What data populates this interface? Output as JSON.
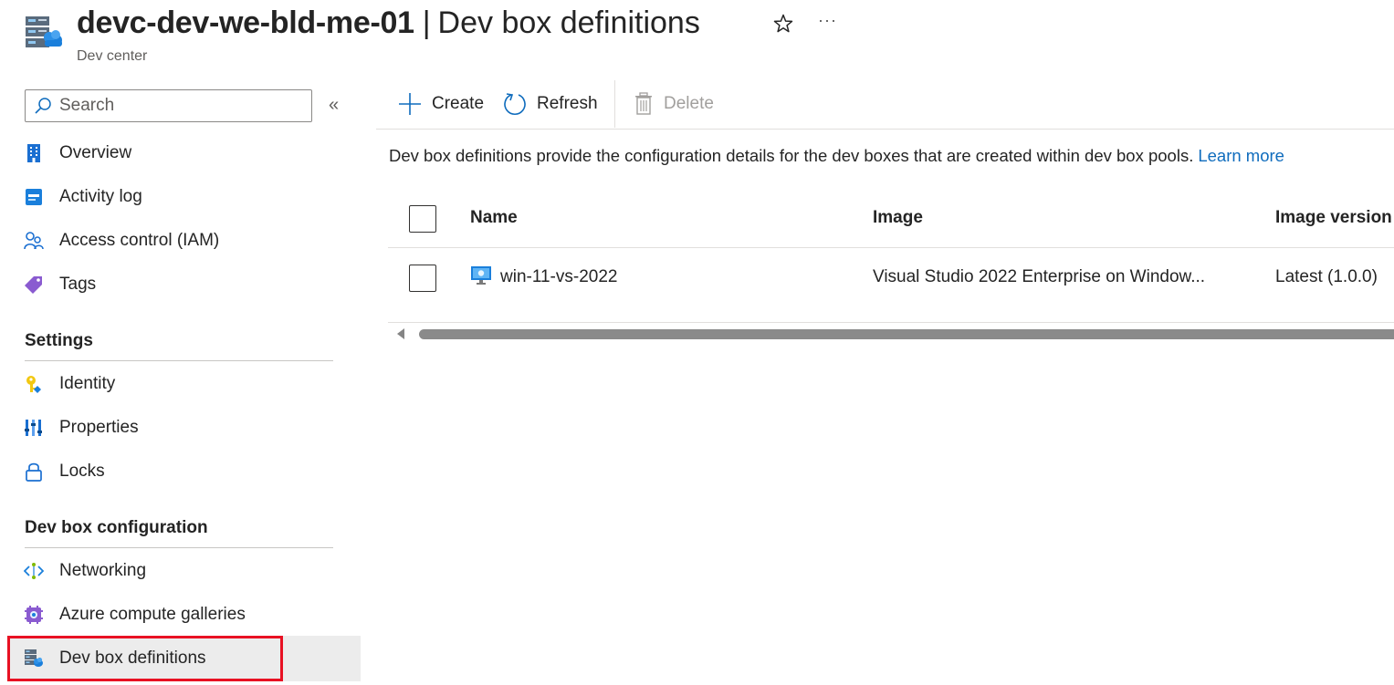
{
  "header": {
    "resource_name": "devc-dev-we-bld-me-01",
    "separator": "|",
    "page_name": "Dev box definitions",
    "subtitle": "Dev center",
    "more_label": "···"
  },
  "sidebar": {
    "search_placeholder": "Search",
    "collapse_label": "«",
    "items": [
      {
        "label": "Overview",
        "icon": "building-icon"
      },
      {
        "label": "Activity log",
        "icon": "activity-log-icon"
      },
      {
        "label": "Access control (IAM)",
        "icon": "people-icon"
      },
      {
        "label": "Tags",
        "icon": "tag-icon"
      }
    ],
    "sections": [
      {
        "title": "Settings",
        "items": [
          {
            "label": "Identity",
            "icon": "key-icon"
          },
          {
            "label": "Properties",
            "icon": "properties-icon"
          },
          {
            "label": "Locks",
            "icon": "lock-icon"
          }
        ]
      },
      {
        "title": "Dev box configuration",
        "items": [
          {
            "label": "Networking",
            "icon": "network-icon"
          },
          {
            "label": "Azure compute galleries",
            "icon": "gallery-icon"
          },
          {
            "label": "Dev box definitions",
            "icon": "dev-box-icon",
            "selected": true
          }
        ]
      }
    ]
  },
  "toolbar": {
    "create_label": "Create",
    "refresh_label": "Refresh",
    "delete_label": "Delete"
  },
  "main": {
    "description": "Dev box definitions provide the configuration details for the dev boxes that are created within dev box pools.",
    "learn_more": "Learn more"
  },
  "table": {
    "columns": [
      "Name",
      "Image",
      "Image version"
    ],
    "rows": [
      {
        "name": "win-11-vs-2022",
        "image": "Visual Studio 2022 Enterprise on Window...",
        "image_version": "Latest (1.0.0)"
      }
    ]
  },
  "colors": {
    "accent": "#0f6cbd",
    "selected_bg": "#ececec",
    "highlight": "#e81123"
  }
}
